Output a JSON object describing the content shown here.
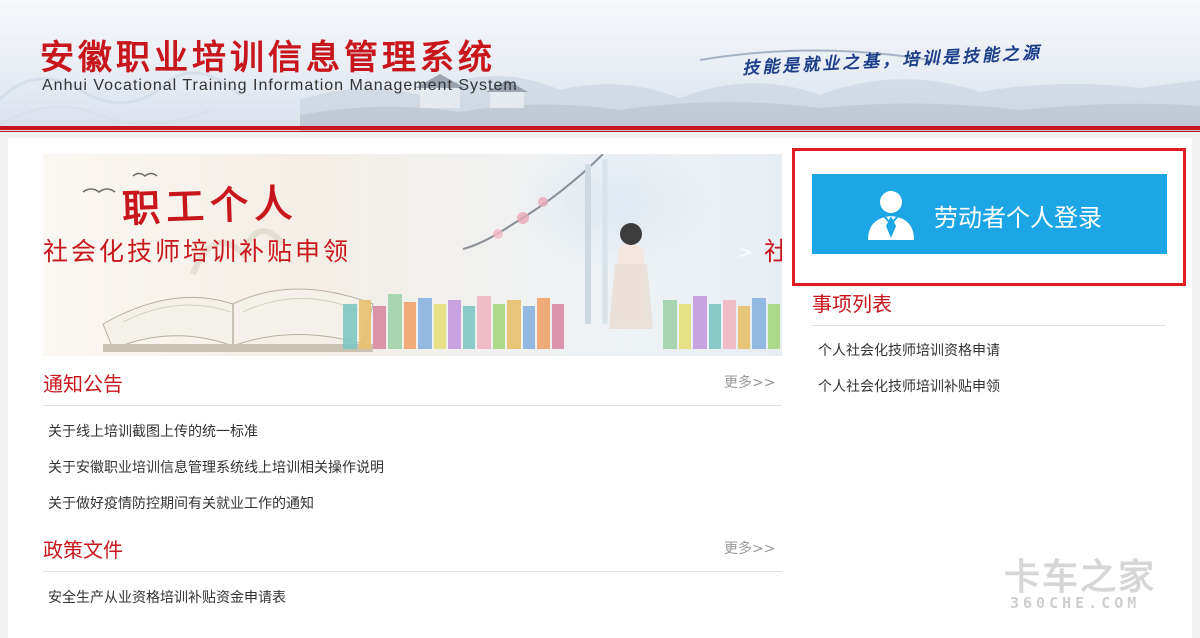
{
  "header": {
    "title": "安徽职业培训信息管理系统",
    "subtitle": "Anhui Vocational Training Information Management System",
    "slogan": "技能是就业之基，培训是技能之源",
    "accent_color": "#c8161d"
  },
  "banner": {
    "title": "职工个人",
    "subtitle": "社会化技师培训补贴申领",
    "next_arrow": ">",
    "next_clip_char": "社"
  },
  "login": {
    "button_label": "劳动者个人登录",
    "icon": "user-avatar-icon",
    "button_color": "#1ca6e6",
    "highlight_color": "#e01b22"
  },
  "notices": {
    "title": "通知公告",
    "more": "更多>>",
    "items": [
      "关于线上培训截图上传的统一标准",
      "关于安徽职业培训信息管理系统线上培训相关操作说明",
      "关于做好疫情防控期间有关就业工作的通知"
    ]
  },
  "policies": {
    "title": "政策文件",
    "more": "更多>>",
    "items": [
      "安全生产从业资格培训补贴资金申请表"
    ]
  },
  "matters": {
    "title": "事项列表",
    "items": [
      "个人社会化技师培训资格申请",
      "个人社会化技师培训补贴申领"
    ]
  },
  "watermark": {
    "text_cn": "卡车之家",
    "text_en": "360CHE.COM"
  }
}
